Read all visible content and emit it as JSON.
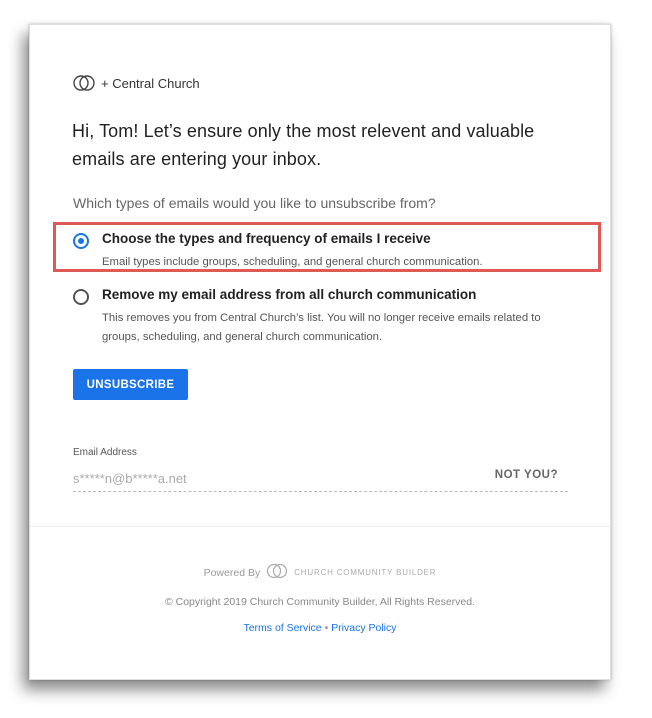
{
  "brand": {
    "logo_icon": "overlapping-circles-logo",
    "name": "+ Central Church"
  },
  "headline": "Hi, Tom! Let’s ensure only the most relevent and valuable emails are entering your inbox.",
  "question": "Which types of emails would you like to unsubscribe from?",
  "options": [
    {
      "title": "Choose the types and frequency of emails I receive",
      "description": "Email types include groups, scheduling, and general church communication.",
      "selected": true
    },
    {
      "title": "Remove my email address from all church communication",
      "description": "This removes you from Central Church’s list. You will no longer receive emails related to groups, scheduling, and general church communication.",
      "selected": false
    }
  ],
  "unsubscribe_label": "UNSUBSCRIBE",
  "email": {
    "label": "Email Address",
    "value": "s*****n@b*****a.net",
    "not_you": "NOT YOU?"
  },
  "footer": {
    "powered_by": "Powered By",
    "ccb_name": "CHURCH COMMUNITY BUILDER",
    "copyright": "© Copyright 2019 Church Community Builder, All Rights Reserved.",
    "terms": "Terms of Service",
    "separator": "•",
    "privacy": "Privacy Policy"
  },
  "colors": {
    "accent": "#1a73e8",
    "highlight_border": "#e05a55"
  }
}
